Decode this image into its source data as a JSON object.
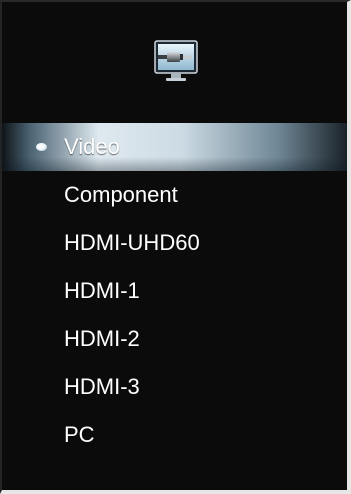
{
  "header": {
    "icon": "input-source-cable-icon"
  },
  "menu": {
    "items": [
      {
        "label": "Video",
        "selected": true
      },
      {
        "label": "Component",
        "selected": false
      },
      {
        "label": "HDMI-UHD60",
        "selected": false
      },
      {
        "label": "HDMI-1",
        "selected": false
      },
      {
        "label": "HDMI-2",
        "selected": false
      },
      {
        "label": "HDMI-3",
        "selected": false
      },
      {
        "label": "PC",
        "selected": false
      }
    ]
  },
  "colors": {
    "background": "#0b0b0b",
    "text": "#ffffff",
    "highlight": "#dfe9ef",
    "border": "#e6e6e6"
  }
}
